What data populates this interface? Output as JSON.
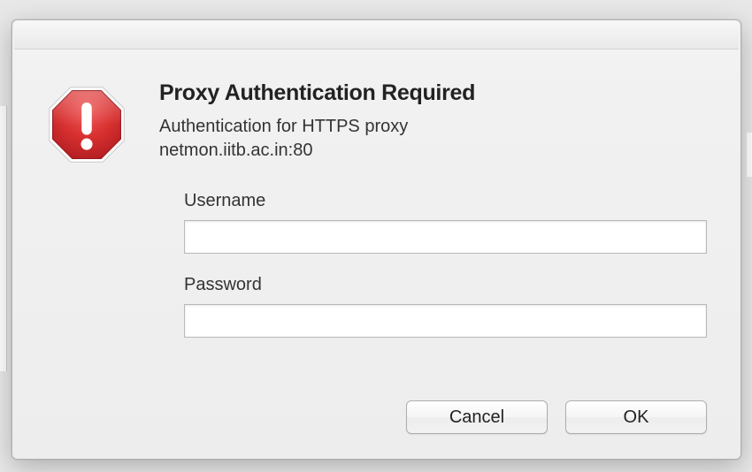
{
  "dialog": {
    "title": "Proxy Authentication Required",
    "subtitle_line1": "Authentication for HTTPS proxy",
    "subtitle_line2": "netmon.iitb.ac.in:80",
    "username_label": "Username",
    "password_label": "Password",
    "username_value": "",
    "password_value": "",
    "cancel_label": "Cancel",
    "ok_label": "OK"
  },
  "icons": {
    "alert": "alert-octagon"
  },
  "colors": {
    "alert_red_top": "#e44848",
    "alert_red_bottom": "#c11f24",
    "alert_border": "#9a1a1e"
  }
}
